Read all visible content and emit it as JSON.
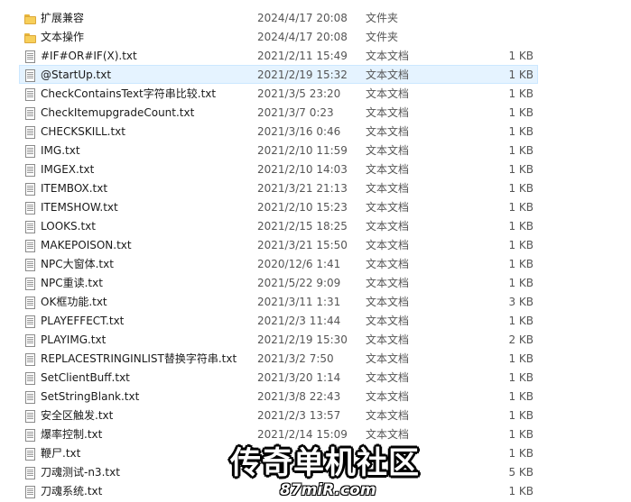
{
  "files": [
    {
      "name": "扩展兼容",
      "date": "2024/4/17 20:08",
      "type": "文件夹",
      "size": "",
      "icon": "folder-icon"
    },
    {
      "name": "文本操作",
      "date": "2024/4/17 20:08",
      "type": "文件夹",
      "size": "",
      "icon": "folder-icon"
    },
    {
      "name": "#IF#OR#IF(X).txt",
      "date": "2021/2/11 15:49",
      "type": "文本文档",
      "size": "1 KB",
      "icon": "text-file-icon"
    },
    {
      "name": "@StartUp.txt",
      "date": "2021/2/19 15:32",
      "type": "文本文档",
      "size": "1 KB",
      "icon": "text-file-icon",
      "selected": true
    },
    {
      "name": "CheckContainsText字符串比较.txt",
      "date": "2021/3/5 23:20",
      "type": "文本文档",
      "size": "1 KB",
      "icon": "text-file-icon"
    },
    {
      "name": "CheckItemupgradeCount.txt",
      "date": "2021/3/7 0:23",
      "type": "文本文档",
      "size": "1 KB",
      "icon": "text-file-icon"
    },
    {
      "name": "CHECKSKILL.txt",
      "date": "2021/3/16 0:46",
      "type": "文本文档",
      "size": "1 KB",
      "icon": "text-file-icon"
    },
    {
      "name": "IMG.txt",
      "date": "2021/2/10 11:59",
      "type": "文本文档",
      "size": "1 KB",
      "icon": "text-file-icon"
    },
    {
      "name": "IMGEX.txt",
      "date": "2021/2/10 14:03",
      "type": "文本文档",
      "size": "1 KB",
      "icon": "text-file-icon"
    },
    {
      "name": "ITEMBOX.txt",
      "date": "2021/3/21 21:13",
      "type": "文本文档",
      "size": "1 KB",
      "icon": "text-file-icon"
    },
    {
      "name": "ITEMSHOW.txt",
      "date": "2021/2/10 15:23",
      "type": "文本文档",
      "size": "1 KB",
      "icon": "text-file-icon"
    },
    {
      "name": "LOOKS.txt",
      "date": "2021/2/15 18:25",
      "type": "文本文档",
      "size": "1 KB",
      "icon": "text-file-icon"
    },
    {
      "name": "MAKEPOISON.txt",
      "date": "2021/3/21 15:50",
      "type": "文本文档",
      "size": "1 KB",
      "icon": "text-file-icon"
    },
    {
      "name": "NPC大窗体.txt",
      "date": "2020/12/6 1:41",
      "type": "文本文档",
      "size": "1 KB",
      "icon": "text-file-icon"
    },
    {
      "name": "NPC重读.txt",
      "date": "2021/5/22 9:09",
      "type": "文本文档",
      "size": "1 KB",
      "icon": "text-file-icon"
    },
    {
      "name": "OK框功能.txt",
      "date": "2021/3/11 1:31",
      "type": "文本文档",
      "size": "3 KB",
      "icon": "text-file-icon"
    },
    {
      "name": "PLAYEFFECT.txt",
      "date": "2021/2/3 11:44",
      "type": "文本文档",
      "size": "1 KB",
      "icon": "text-file-icon"
    },
    {
      "name": "PLAYIMG.txt",
      "date": "2021/2/19 15:30",
      "type": "文本文档",
      "size": "2 KB",
      "icon": "text-file-icon"
    },
    {
      "name": "REPLACESTRINGINLIST替换字符串.txt",
      "date": "2021/3/2 7:50",
      "type": "文本文档",
      "size": "1 KB",
      "icon": "text-file-icon"
    },
    {
      "name": "SetClientBuff.txt",
      "date": "2021/3/20 1:14",
      "type": "文本文档",
      "size": "1 KB",
      "icon": "text-file-icon"
    },
    {
      "name": "SetStringBlank.txt",
      "date": "2021/3/8 22:43",
      "type": "文本文档",
      "size": "1 KB",
      "icon": "text-file-icon"
    },
    {
      "name": "安全区触发.txt",
      "date": "2021/2/3 13:57",
      "type": "文本文档",
      "size": "1 KB",
      "icon": "text-file-icon"
    },
    {
      "name": "爆率控制.txt",
      "date": "2021/2/14 15:09",
      "type": "文本文档",
      "size": "1 KB",
      "icon": "text-file-icon"
    },
    {
      "name": "鞭尸.txt",
      "date": "",
      "type": "",
      "size": "1 KB",
      "icon": "text-file-icon"
    },
    {
      "name": "刀魂测试-n3.txt",
      "date": "",
      "type": "",
      "size": "5 KB",
      "icon": "text-file-icon"
    },
    {
      "name": "刀魂系统.txt",
      "date": "",
      "type": "",
      "size": "1 KB",
      "icon": "text-file-icon"
    }
  ],
  "watermark": {
    "main": "传奇单机社区",
    "url": "87miR.com"
  }
}
